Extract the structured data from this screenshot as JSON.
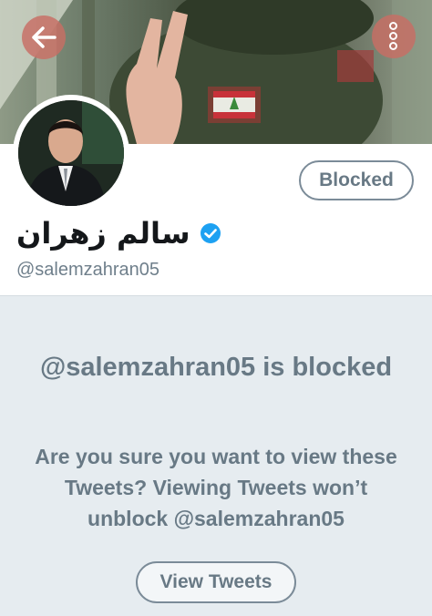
{
  "header": {
    "back_icon": "back-arrow-icon",
    "more_icon": "more-vertical-icon"
  },
  "profile": {
    "display_name": "سالم زهران",
    "handle": "@salemzahran05",
    "verified_icon": "verified-badge-icon",
    "relationship_button_label": "Blocked"
  },
  "blocked_notice": {
    "title": "@salemzahran05 is blocked",
    "message": "Are you sure you want to view these Tweets? Viewing Tweets won’t unblock @salemzahran05",
    "view_button_label": "View Tweets"
  },
  "colors": {
    "accent": "#1da1f2",
    "muted_text": "#687985",
    "panel_background": "#e6ecf0",
    "header_button": "#c86e64"
  }
}
